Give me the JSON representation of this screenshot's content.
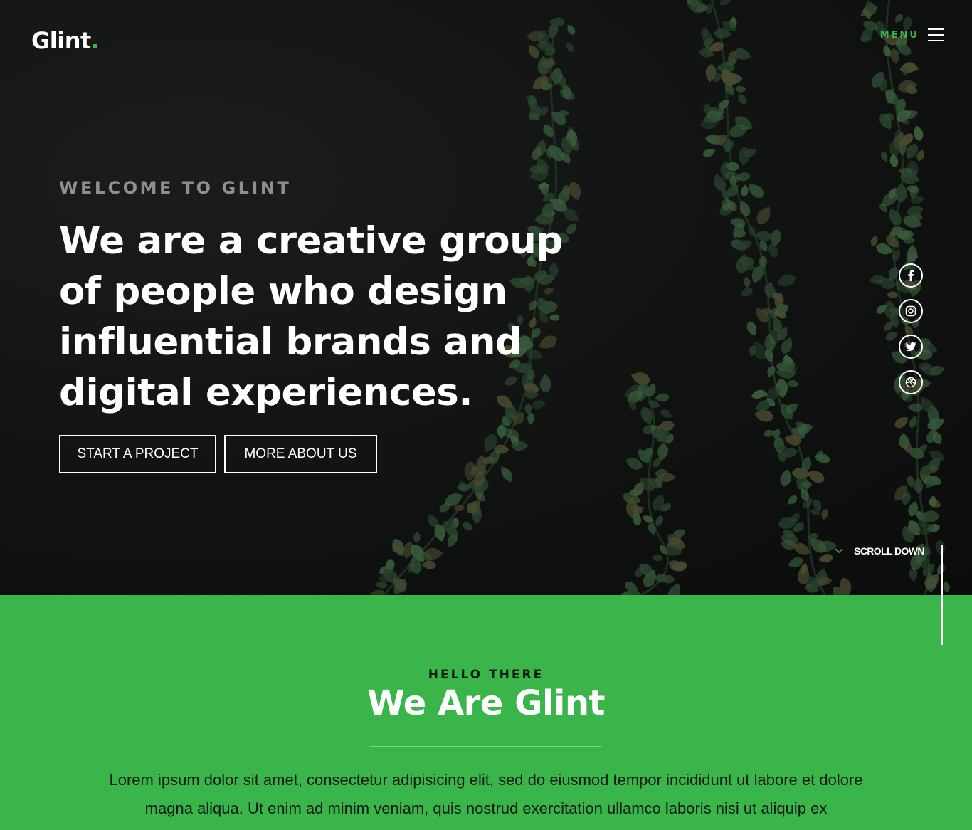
{
  "header": {
    "logo_text": "Glint",
    "logo_dot": ".",
    "menu_label": "MENU"
  },
  "hero": {
    "eyebrow": "WELCOME TO GLINT",
    "headline": "We are a creative group of people who design influential brands and digital experiences.",
    "buttons": {
      "start": "START A PROJECT",
      "more": "MORE ABOUT US"
    },
    "social_icons": [
      "facebook-icon",
      "instagram-icon",
      "twitter-icon",
      "dribbble-icon"
    ],
    "scroll_label": "SCROLL DOWN"
  },
  "about": {
    "eyebrow": "HELLO THERE",
    "title": "We Are Glint",
    "text": "Lorem ipsum dolor sit amet, consectetur adipisicing elit, sed do eiusmod tempor incididunt ut labore et dolore magna aliqua. Ut enim ad minim veniam, quis nostrud exercitation ullamco laboris nisi ut aliquip ex"
  },
  "colors": {
    "accent": "#39b54a",
    "hero_bg": "#101211",
    "text_white": "#ffffff"
  }
}
